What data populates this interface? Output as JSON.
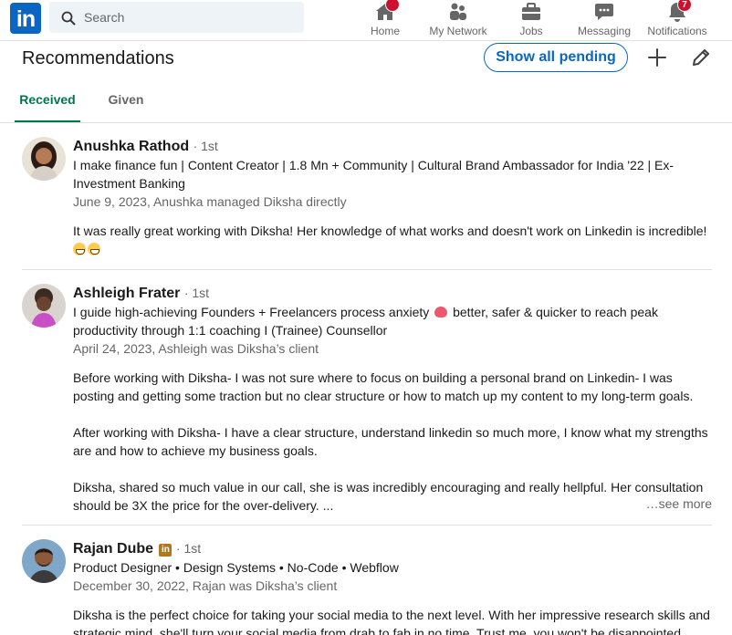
{
  "nav": {
    "logo": "in",
    "search_placeholder": "Search",
    "items": [
      {
        "label": "Home",
        "badge": "",
        "icon": "home-icon"
      },
      {
        "label": "My Network",
        "badge": "",
        "icon": "network-icon"
      },
      {
        "label": "Jobs",
        "badge": "",
        "icon": "briefcase-icon"
      },
      {
        "label": "Messaging",
        "badge": "",
        "icon": "messaging-icon"
      },
      {
        "label": "Notifications",
        "badge": "7",
        "icon": "bell-icon"
      }
    ]
  },
  "header": {
    "title": "Recommendations",
    "show_all_pending": "Show all pending"
  },
  "tabs": [
    {
      "label": "Received",
      "active": true
    },
    {
      "label": "Given",
      "active": false
    }
  ],
  "recommendations": [
    {
      "name": "Anushka Rathod",
      "degree": "· 1st",
      "headline": "I make finance fun | Content Creator | 1.8 Mn + Community | Cultural Brand Ambassador for India '22 | Ex-Investment Banking",
      "meta": "June 9, 2023, Anushka managed Diksha directly",
      "text": [
        "It was really great working with Diksha! Her knowledge of what works and doesn't work on Linkedin is incredible!"
      ]
    },
    {
      "name": "Ashleigh Frater",
      "degree": "· 1st",
      "headline_part1": "I guide high-achieving Founders + Freelancers process anxiety",
      "headline_part2": "better, safer & quicker to reach peak productivity through 1:1 coaching I (Trainee) Counsellor",
      "meta": "April 24, 2023, Ashleigh was Diksha’s client",
      "text": [
        "Before working with Diksha- I was not sure where to focus on building a personal brand on Linkedin- I was posting and getting some traction but no clear structure or how to match up my content to my long-term goals.",
        "After working with Diksha- I have a clear structure, understand linkedin so much more, I know what my strengths are and how to achieve my business goals.",
        "Diksha, shared so much value in our call, she is was incredibly encouraging and really hellpful. Her consultation should be 3X the price for the over-delivery. ..."
      ],
      "see_more": "…see more"
    },
    {
      "name": "Rajan Dube",
      "degree": "· 1st",
      "headline": "Product Designer • Design Systems • No-Code • Webflow",
      "meta": "December 30, 2022, Rajan was Diksha’s client",
      "text": [
        "Diksha is the perfect choice for taking your social media to the next level. With her impressive research skills and strategic mind, she'll turn your social media from drab to fab in no time. Trust me, you won't be disappointed."
      ]
    }
  ],
  "colors": {
    "brand": "#0a66c2",
    "tab_active": "#01754f",
    "badge": "#cb112d",
    "premium_badge": "#b2771b"
  }
}
